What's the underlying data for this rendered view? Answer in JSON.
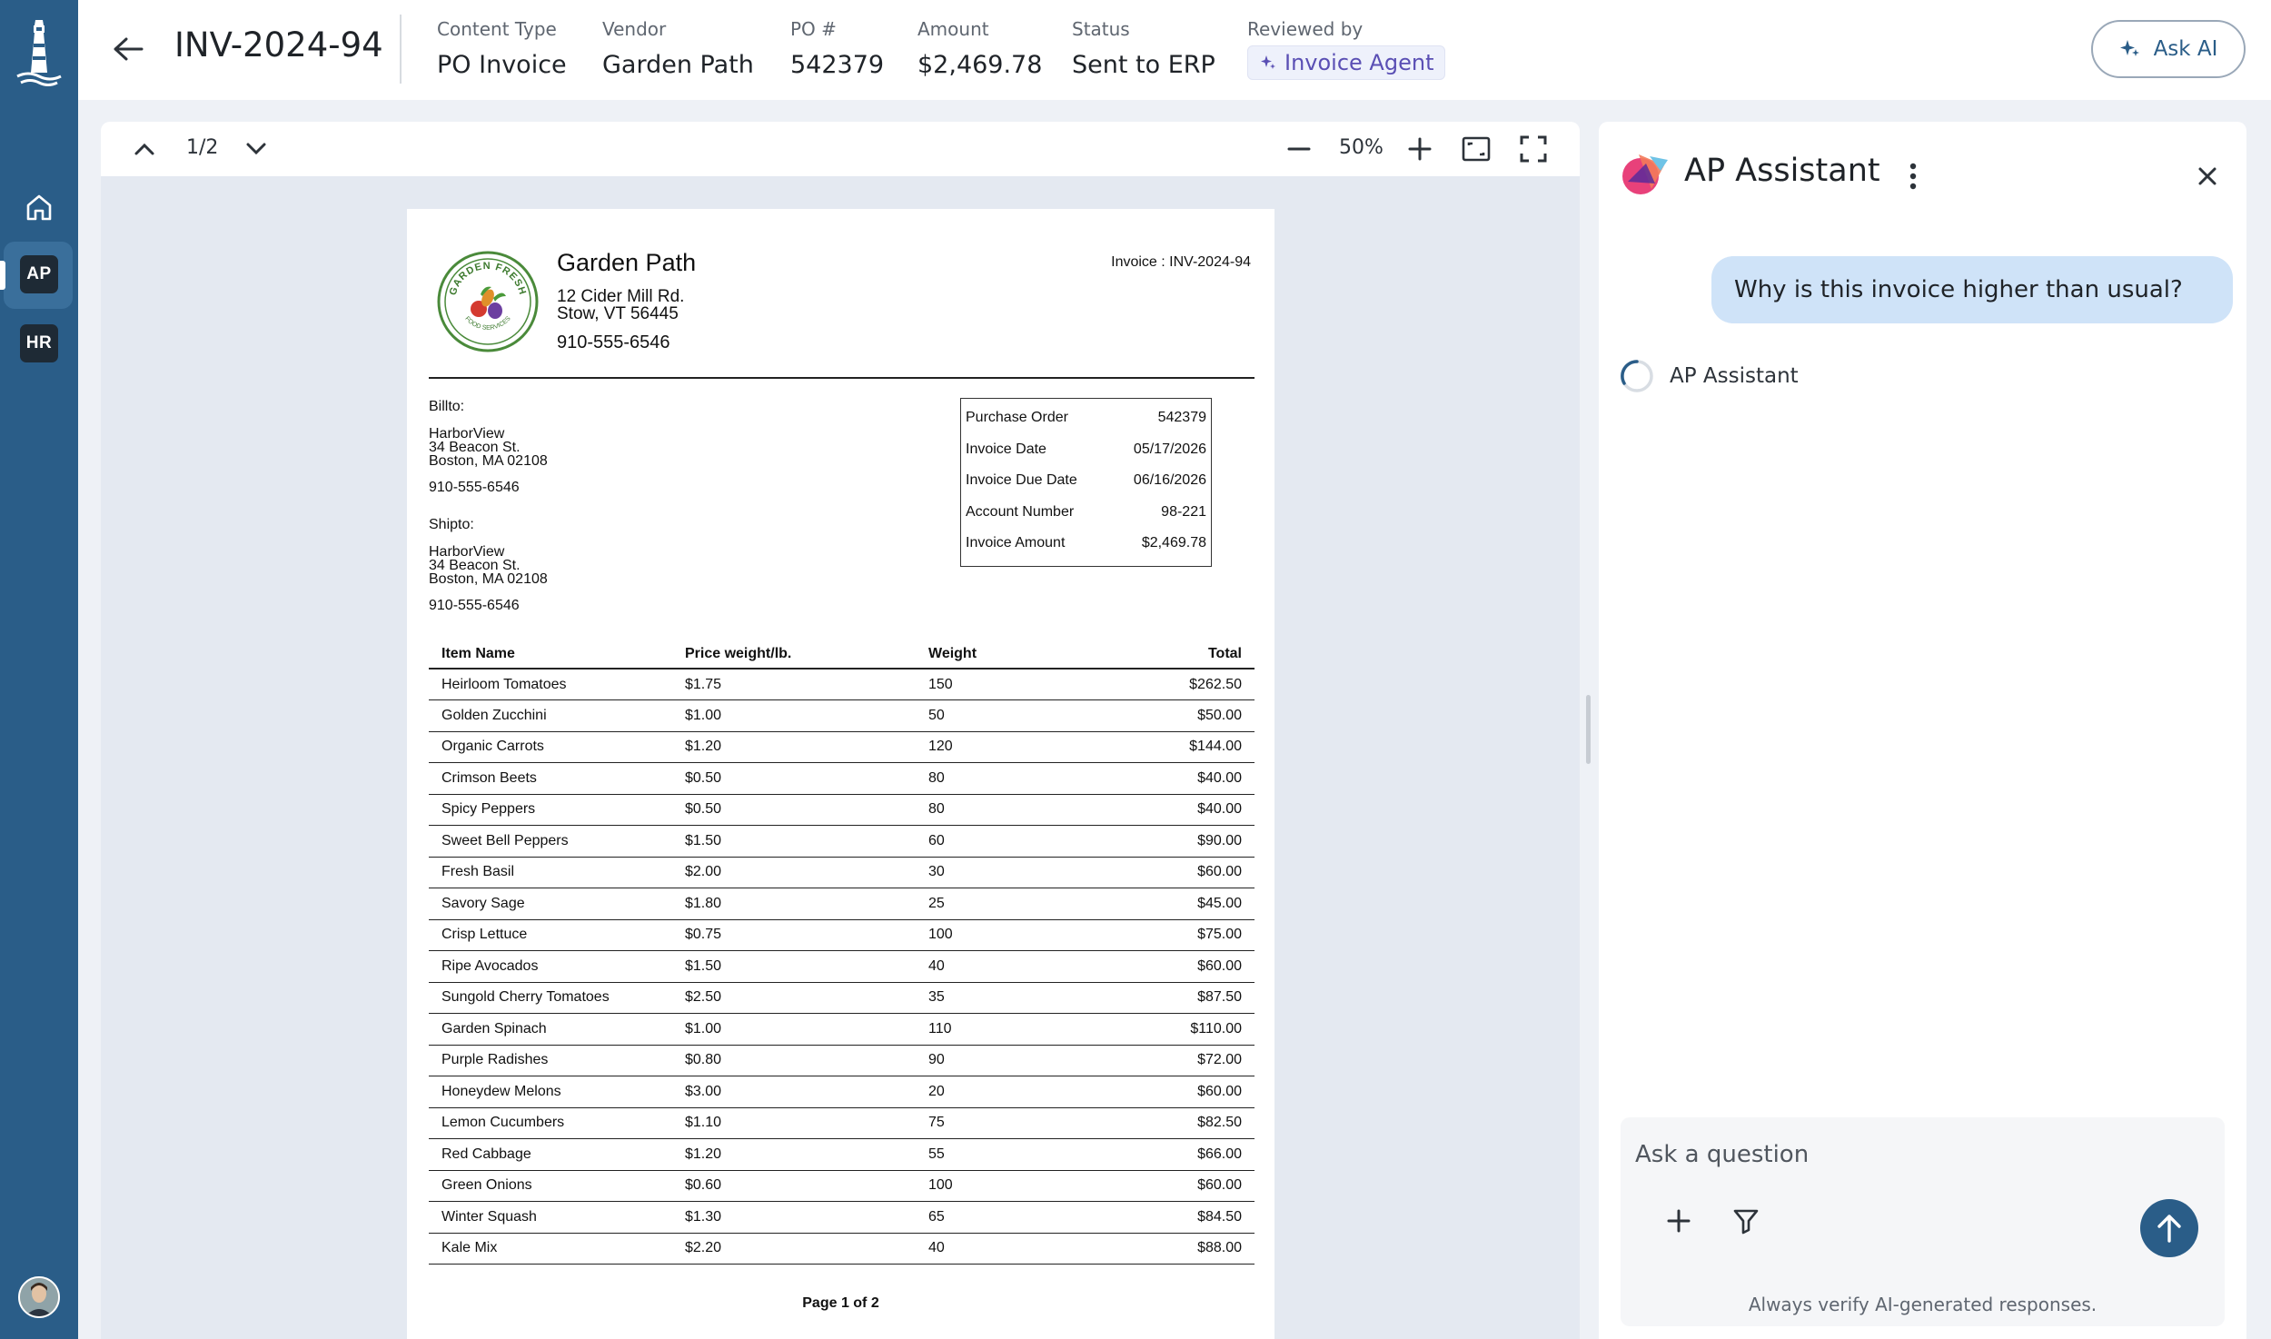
{
  "header": {
    "invoice_id": "INV-2024-94",
    "meta": [
      {
        "label": "Content Type",
        "value": "PO Invoice"
      },
      {
        "label": "Vendor",
        "value": "Garden Path"
      },
      {
        "label": "PO #",
        "value": "542379"
      },
      {
        "label": "Amount",
        "value": "$2,469.78"
      },
      {
        "label": "Status",
        "value": "Sent to ERP"
      }
    ],
    "reviewed_by_label": "Reviewed by",
    "reviewed_by_value": "Invoice Agent",
    "ask_ai_label": "Ask AI"
  },
  "rail": {
    "items": [
      {
        "id": "home",
        "icon": "home-icon"
      },
      {
        "id": "ap",
        "label": "AP"
      },
      {
        "id": "hr",
        "label": "HR"
      }
    ],
    "active": "AP"
  },
  "viewer": {
    "page_indicator": "1/2",
    "zoom": "50%"
  },
  "invoice": {
    "vendor_name": "Garden Path",
    "logo_text_top": "GARDEN FRESH",
    "logo_text_bottom": "FOOD SERVICES",
    "vendor_address_1": "12 Cider Mill Rd.",
    "vendor_address_2": "Stow, VT 56445",
    "vendor_phone": "910-555-6546",
    "invoice_label": "Invoice :  INV-2024-94",
    "bill_to_label": "Billto:",
    "bill_to_name": "HarborView",
    "bill_to_street": "34 Beacon St.",
    "bill_to_city": "Boston, MA 02108",
    "bill_to_phone": "910-555-6546",
    "ship_to_label": "Shipto:",
    "ship_to_name": "HarborView",
    "ship_to_street": "34 Beacon St.",
    "ship_to_city": "Boston, MA 02108",
    "ship_to_phone": "910-555-6546",
    "summary": [
      {
        "label": "Purchase Order",
        "value": "542379"
      },
      {
        "label": "Invoice Date",
        "value": "05/17/2026"
      },
      {
        "label": "Invoice Due Date",
        "value": "06/16/2026"
      },
      {
        "label": "Account Number",
        "value": "98-221"
      },
      {
        "label": "Invoice Amount",
        "value": "$2,469.78"
      }
    ],
    "columns": [
      "Item Name",
      "Price weight/lb.",
      "Weight",
      "Total"
    ],
    "items": [
      [
        "Heirloom Tomatoes",
        "$1.75",
        "150",
        "$262.50"
      ],
      [
        "Golden Zucchini",
        "$1.00",
        "50",
        "$50.00"
      ],
      [
        "Organic Carrots",
        "$1.20",
        "120",
        "$144.00"
      ],
      [
        "Crimson Beets",
        "$0.50",
        "80",
        "$40.00"
      ],
      [
        "Spicy Peppers",
        "$0.50",
        "80",
        "$40.00"
      ],
      [
        "Sweet Bell Peppers",
        "$1.50",
        "60",
        "$90.00"
      ],
      [
        "Fresh Basil",
        "$2.00",
        "30",
        "$60.00"
      ],
      [
        "Savory Sage",
        "$1.80",
        "25",
        "$45.00"
      ],
      [
        "Crisp Lettuce",
        "$0.75",
        "100",
        "$75.00"
      ],
      [
        "Ripe Avocados",
        "$1.50",
        "40",
        "$60.00"
      ],
      [
        "Sungold Cherry Tomatoes",
        "$2.50",
        "35",
        "$87.50"
      ],
      [
        "Garden Spinach",
        "$1.00",
        "110",
        "$110.00"
      ],
      [
        "Purple Radishes",
        "$0.80",
        "90",
        "$72.00"
      ],
      [
        "Honeydew Melons",
        "$3.00",
        "20",
        "$60.00"
      ],
      [
        "Lemon Cucumbers",
        "$1.10",
        "75",
        "$82.50"
      ],
      [
        "Red Cabbage",
        "$1.20",
        "55",
        "$66.00"
      ],
      [
        "Green Onions",
        "$0.60",
        "100",
        "$60.00"
      ],
      [
        "Winter Squash",
        "$1.30",
        "65",
        "$84.50"
      ],
      [
        "Kale Mix",
        "$2.20",
        "40",
        "$88.00"
      ]
    ],
    "footer": "Page 1 of 2"
  },
  "assistant": {
    "title": "AP Assistant",
    "user_message": "Why is this invoice higher than usual?",
    "assistant_name": "AP Assistant",
    "input_placeholder": "Ask a question",
    "disclaimer": "Always verify AI-generated responses."
  },
  "colors": {
    "rail": "#2a5d88",
    "accent": "#2a5d88",
    "user_bubble": "#cfe3f8",
    "agent_chip_text": "#5a4fb4"
  }
}
